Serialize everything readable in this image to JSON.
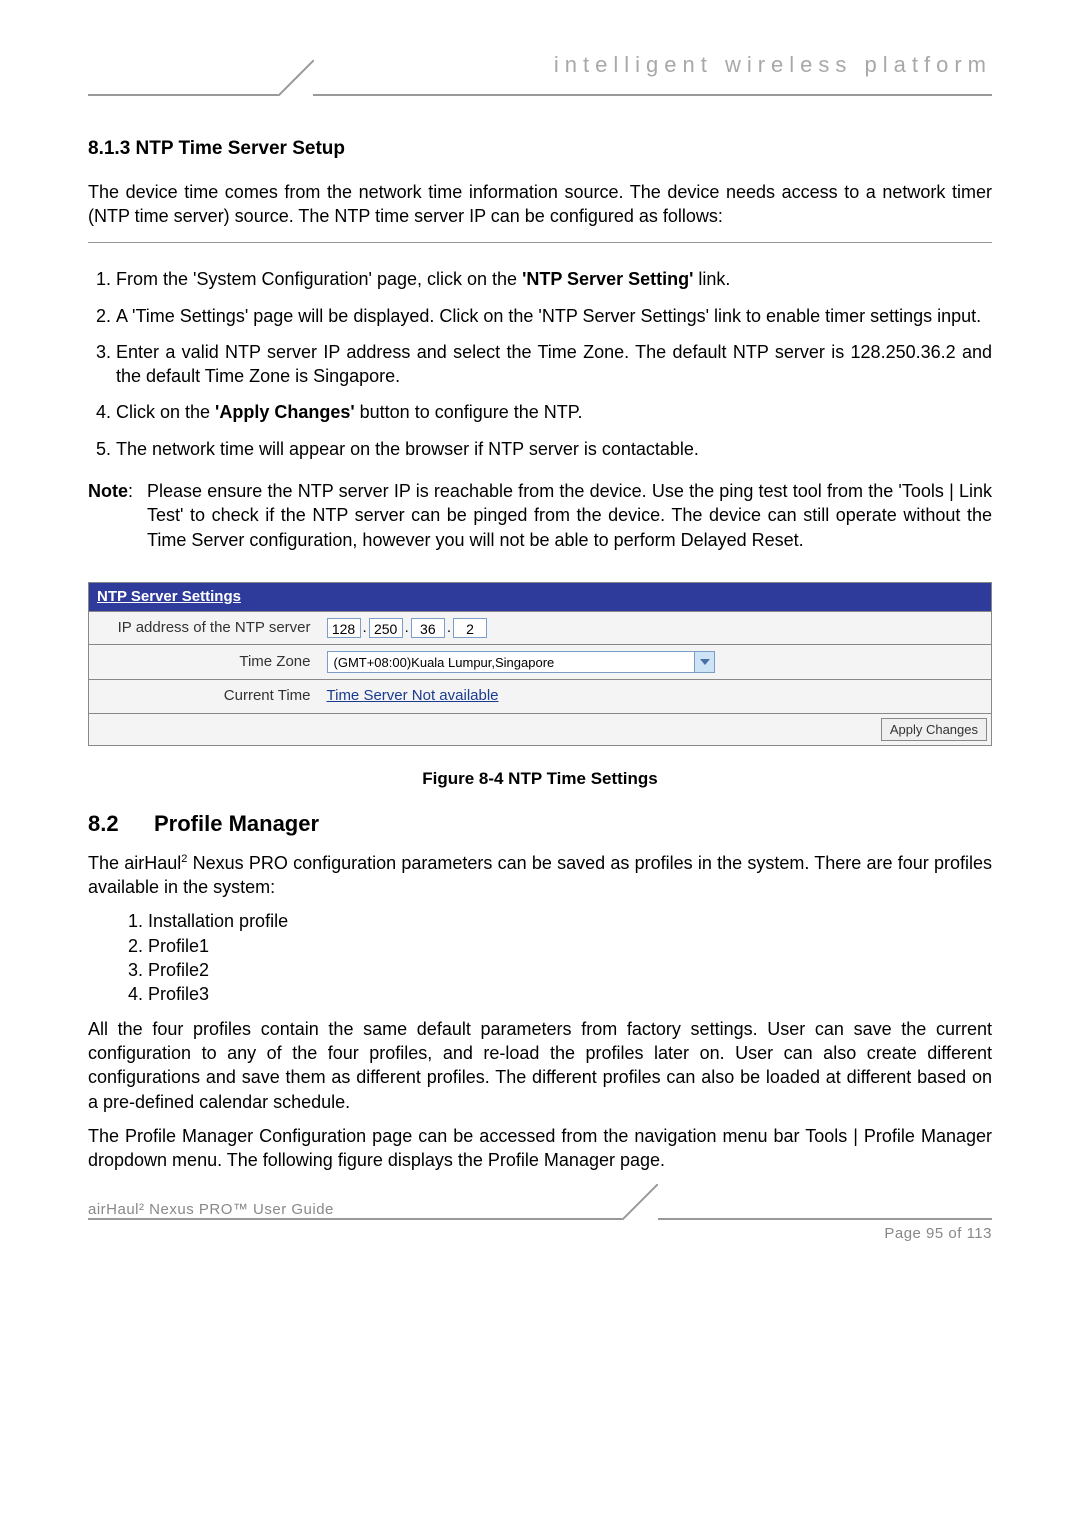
{
  "header": {
    "tagline": "intelligent  wireless  platform"
  },
  "section_813": {
    "number": "8.1.3",
    "title": "NTP Time Server Setup",
    "intro": "The device time comes from the network time information source. The device needs access to a network timer (NTP time server) source. The NTP time server IP can be configured as follows:",
    "step1_a": "From the 'System Configuration' page, click on the ",
    "step1_b": "'NTP Server Setting'",
    "step1_c": " link.",
    "step2": "A 'Time Settings' page will be displayed.  Click on the 'NTP Server Settings' link to enable timer settings input.",
    "step3": "Enter a valid NTP server IP address and select the Time Zone.  The default NTP server is 128.250.36.2 and the default Time Zone is Singapore.",
    "step4_a": "Click on the ",
    "step4_b": "'Apply Changes'",
    "step4_c": " button to configure the NTP.",
    "step5": "The network time will appear on the browser if NTP server is contactable.",
    "note_label": "Note",
    "note_body": "Please ensure the NTP server IP is reachable from the device. Use the ping test tool from the 'Tools | Link Test' to check if the NTP server can be pinged from the device. The device can still operate without the Time Server configuration, however you will not be able to perform Delayed Reset."
  },
  "ntp_panel": {
    "title": "NTP Server Settings",
    "ip_label": "IP address of the NTP server",
    "ip": {
      "o1": "128",
      "o2": "250",
      "o3": "36",
      "o4": "2"
    },
    "tz_label": "Time Zone",
    "tz_value": "(GMT+08:00)Kuala Lumpur,Singapore",
    "ct_label": "Current Time",
    "ct_value": "Time Server Not available",
    "apply_label": "Apply Changes"
  },
  "figure_caption": "Figure 8-4 NTP Time Settings",
  "section_82": {
    "number": "8.2",
    "title": "Profile Manager",
    "intro_a": "The airHaul",
    "intro_sup": "2",
    "intro_b": " Nexus PRO configuration parameters can be saved as profiles in the system. There are four profiles available in the system:",
    "items": {
      "i1": "Installation profile",
      "i2": "Profile1",
      "i3": "Profile2",
      "i4": "Profile3"
    },
    "para2": "All the four profiles contain the same default parameters from factory settings. User can save the current configuration to any of the four profiles, and re-load the profiles later on. User can also create different configurations and save them as different profiles. The different profiles can also be loaded at different based on a pre-defined calendar schedule.",
    "para3": "The Profile Manager Configuration page can be accessed from the navigation menu bar Tools | Profile Manager dropdown menu. The following figure displays the Profile Manager page."
  },
  "footer": {
    "left": "airHaul² Nexus PRO™ User Guide",
    "right": "Page 95 of 113"
  }
}
